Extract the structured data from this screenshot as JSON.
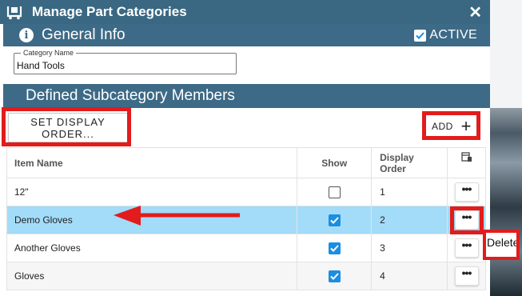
{
  "dialog": {
    "title": "Manage Part Categories",
    "close_label": "✕"
  },
  "general": {
    "section_title": "General Info",
    "active_label": "ACTIVE",
    "active_checked": true,
    "category_name_label": "Category Name",
    "category_name_value": "Hand Tools"
  },
  "members": {
    "section_title": "Defined Subcategory Members",
    "set_order_line1": "SET DISPLAY",
    "set_order_line2": "ORDER...",
    "add_label": "ADD",
    "add_icon": "+",
    "columns": {
      "item_name": "Item Name",
      "show": "Show",
      "display_order_1": "Display",
      "display_order_2": "Order"
    },
    "rows": [
      {
        "name": "12\"",
        "show": false,
        "order": "1"
      },
      {
        "name": "Demo Gloves",
        "show": true,
        "order": "2"
      },
      {
        "name": "Another Gloves",
        "show": true,
        "order": "3"
      },
      {
        "name": "Gloves",
        "show": true,
        "order": "4"
      }
    ],
    "more_label": "•••",
    "delete_label": "Delete"
  },
  "colors": {
    "header_bg": "#3a6883",
    "section_bg": "#3d6a86",
    "highlight_red": "#e21c1c",
    "selected_row": "#a3dcf8",
    "checkbox_blue": "#1a8ee2"
  }
}
